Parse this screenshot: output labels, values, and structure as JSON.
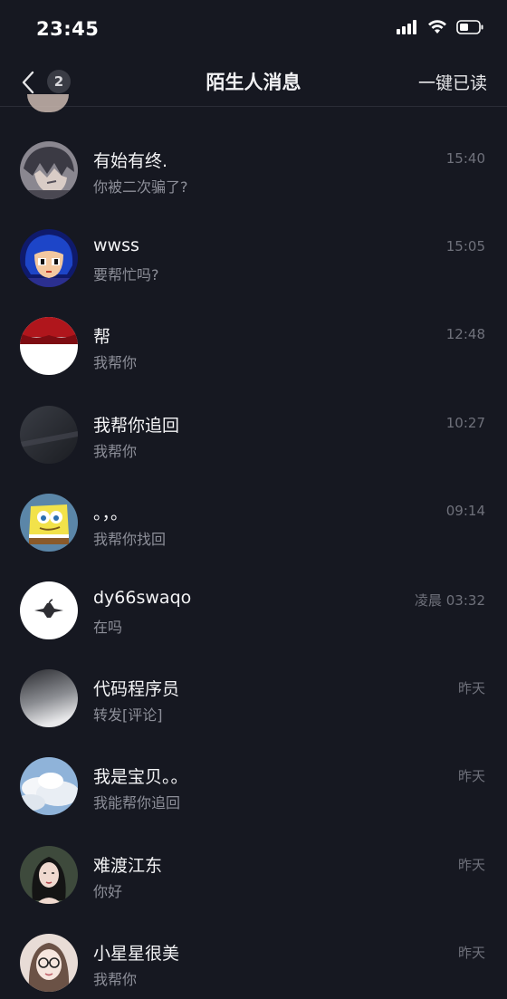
{
  "status_bar": {
    "time": "23:45",
    "icons": [
      "cellular-signal-icon",
      "wifi-icon",
      "battery-icon"
    ]
  },
  "nav": {
    "back_icon": "chevron-left-icon",
    "unread_count": "2",
    "title": "陌生人消息",
    "mark_all_read": "一键已读"
  },
  "conversations": [
    {
      "name": "有始有终.",
      "preview": "你被二次骗了?",
      "time": "15:40",
      "avatar": "anime-boy-avatar"
    },
    {
      "name": "wwss",
      "preview": "要帮忙吗?",
      "time": "15:05",
      "avatar": "pixel-girl-avatar"
    },
    {
      "name": "帮",
      "preview": "我帮你",
      "time": "12:48",
      "avatar": "red-white-avatar"
    },
    {
      "name": "我帮你追回",
      "preview": "我帮你",
      "time": "10:27",
      "avatar": "dark-gradient-avatar"
    },
    {
      "name": "。，。",
      "preview": "我帮你找回",
      "time": "09:14",
      "avatar": "spongebob-avatar"
    },
    {
      "name": "dy66swaqo",
      "preview": "在吗",
      "time": "凌晨 03:32",
      "avatar": "apple-logo-avatar"
    },
    {
      "name": "代码程序员",
      "preview": "转发[评论]",
      "time": "昨天",
      "avatar": "gray-gradient-avatar"
    },
    {
      "name": "我是宝贝。。",
      "preview": "我能帮你追回",
      "time": "昨天",
      "avatar": "cloud-sky-avatar"
    },
    {
      "name": "难渡江东",
      "preview": "你好",
      "time": "昨天",
      "avatar": "girl-portrait-avatar"
    },
    {
      "name": "小星星很美",
      "preview": "我帮你",
      "time": "昨天",
      "avatar": "glasses-girl-avatar"
    }
  ],
  "colors": {
    "background": "#161821",
    "name_text": "#f3f3f5",
    "preview_text": "#8d8f99",
    "time_text": "#6f717b"
  }
}
